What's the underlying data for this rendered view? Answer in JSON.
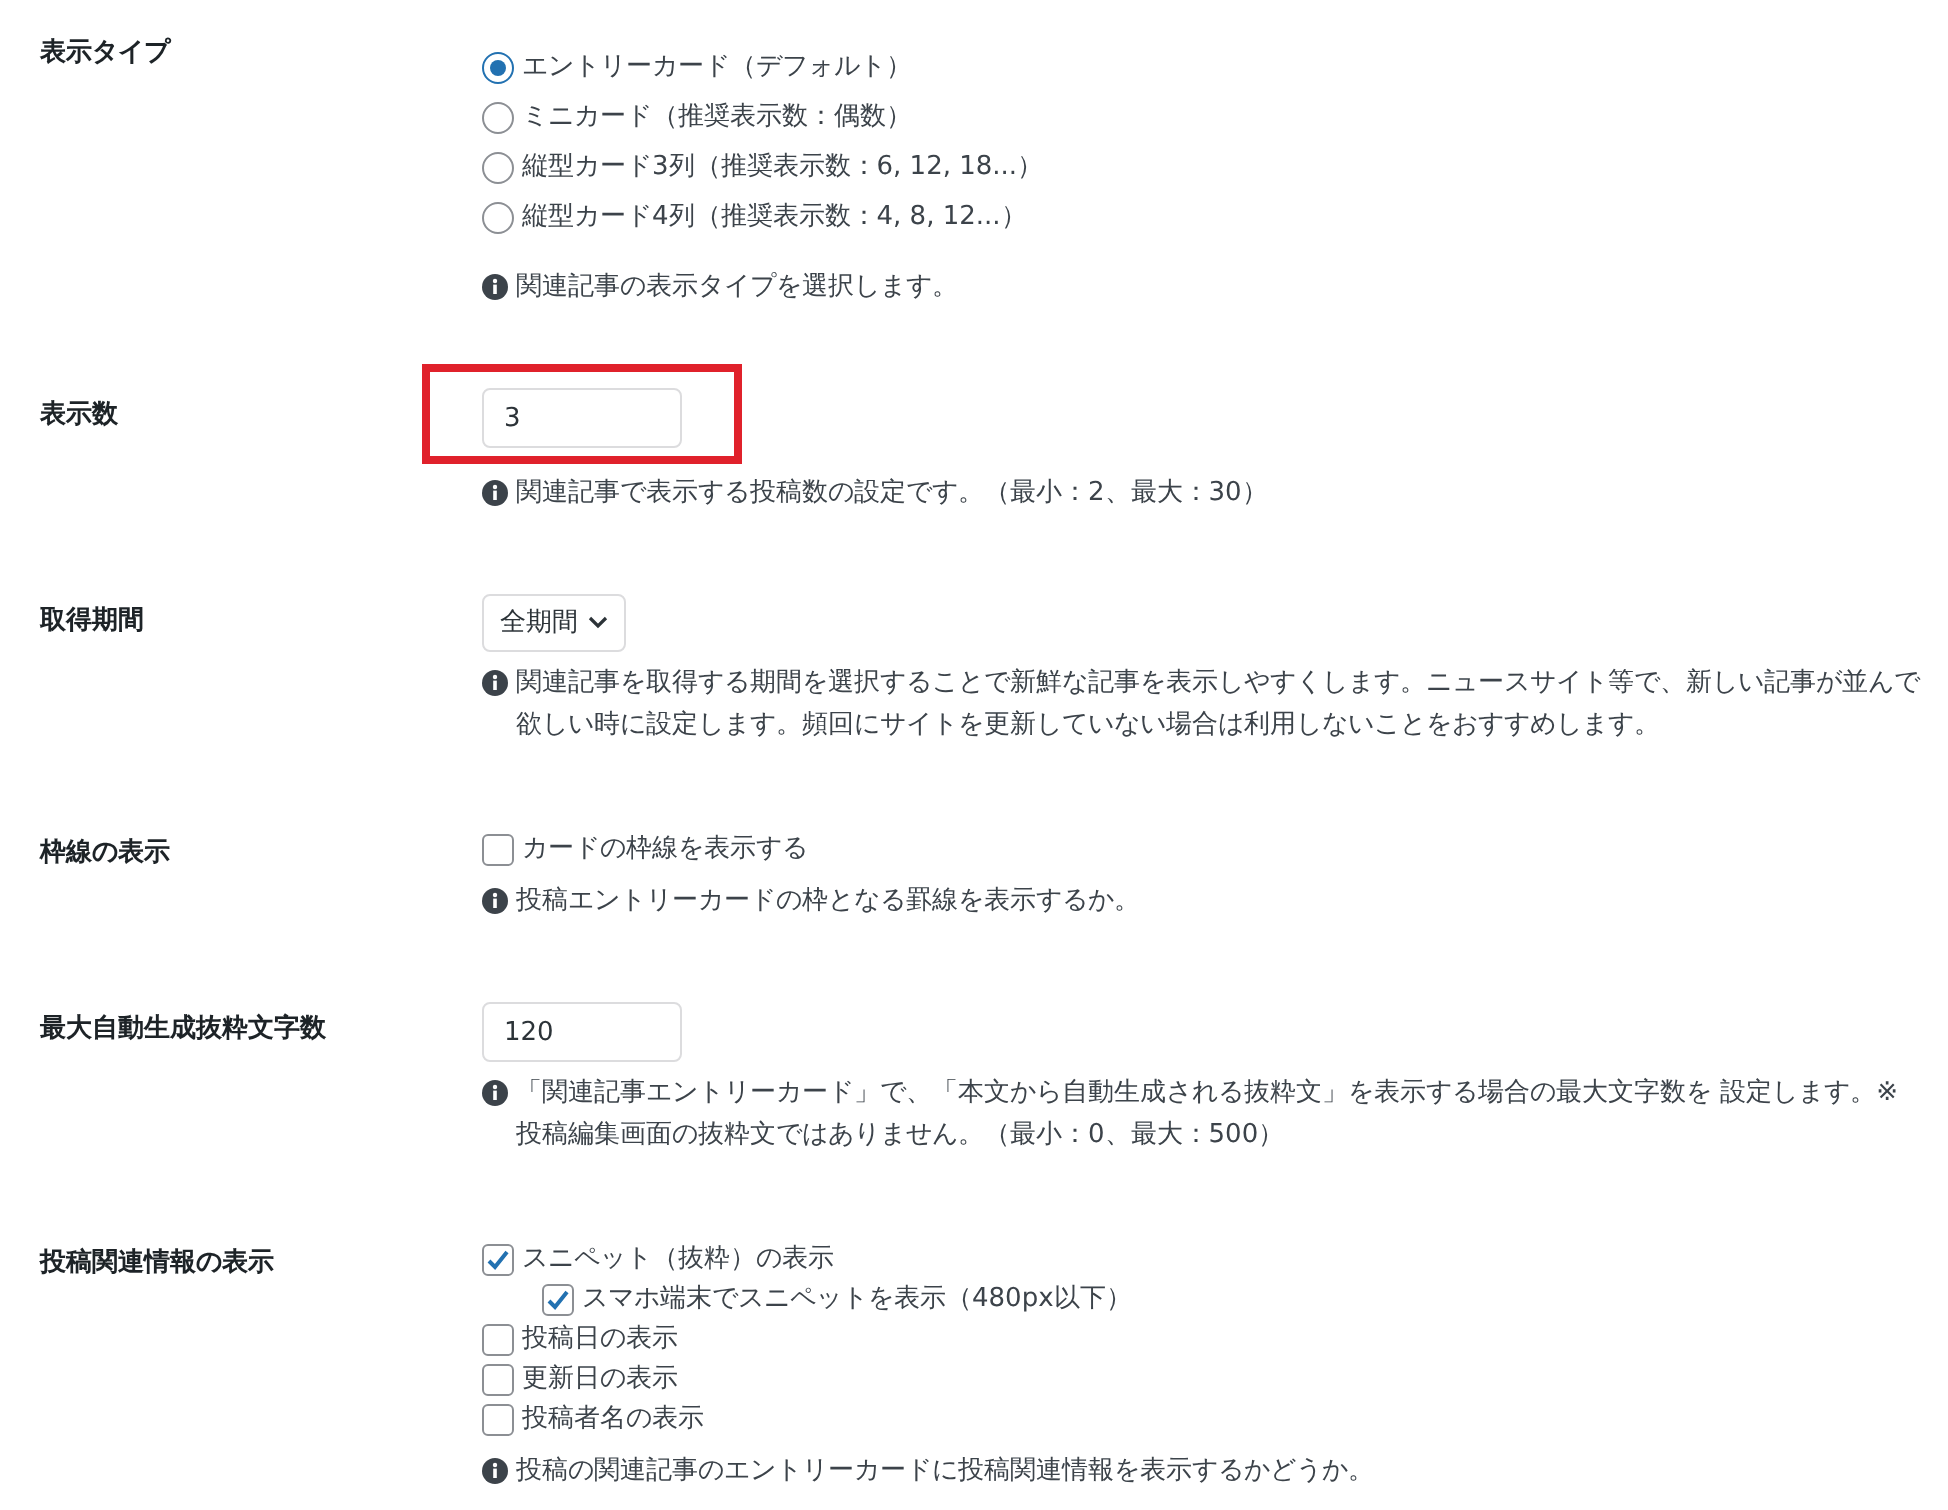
{
  "settings": [
    {
      "label": "表示タイプ",
      "kind": "radios",
      "options": [
        {
          "label": "エントリーカード（デフォルト）",
          "selected": true
        },
        {
          "label": "ミニカード（推奨表示数：偶数）",
          "selected": false
        },
        {
          "label": "縦型カード3列（推奨表示数：6, 12, 18...）",
          "selected": false
        },
        {
          "label": "縦型カード4列（推奨表示数：4, 8, 12...）",
          "selected": false
        }
      ],
      "help": "関連記事の表示タイプを選択します。"
    },
    {
      "label": "表示数",
      "kind": "number",
      "value": "3",
      "highlighted": true,
      "help": "関連記事で表示する投稿数の設定です。（最小：2、最大：30）"
    },
    {
      "label": "取得期間",
      "kind": "select",
      "value": "全期間",
      "help": "関連記事を取得する期間を選択することで新鮮な記事を表示しやすくします。ニュースサイト等で、新しい記事が並んで欲しい時に設定します。頻回にサイトを更新していない場合は利用しないことをおすすめします。"
    },
    {
      "label": "枠線の表示",
      "kind": "checkboxes",
      "options": [
        {
          "label": "カードの枠線を表示する",
          "checked": false
        }
      ],
      "help": "投稿エントリーカードの枠となる罫線を表示するか。"
    },
    {
      "label": "最大自動生成抜粋文字数",
      "kind": "number",
      "value": "120",
      "highlighted": false,
      "help": "「関連記事エントリーカード」で、「本文から自動生成される抜粋文」を表示する場合の最大文字数を 設定します。※投稿編集画面の抜粋文ではありません。（最小：0、最大：500）"
    },
    {
      "label": "投稿関連情報の表示",
      "kind": "checkboxes",
      "options": [
        {
          "label": "スニペット（抜粋）の表示",
          "checked": true,
          "children": [
            {
              "label": "スマホ端末でスニペットを表示（480px以下）",
              "checked": true
            }
          ]
        },
        {
          "label": "投稿日の表示",
          "checked": false
        },
        {
          "label": "更新日の表示",
          "checked": false
        },
        {
          "label": "投稿者名の表示",
          "checked": false
        }
      ],
      "help": "投稿の関連記事のエントリーカードに投稿関連情報を表示するかどうか。"
    }
  ]
}
